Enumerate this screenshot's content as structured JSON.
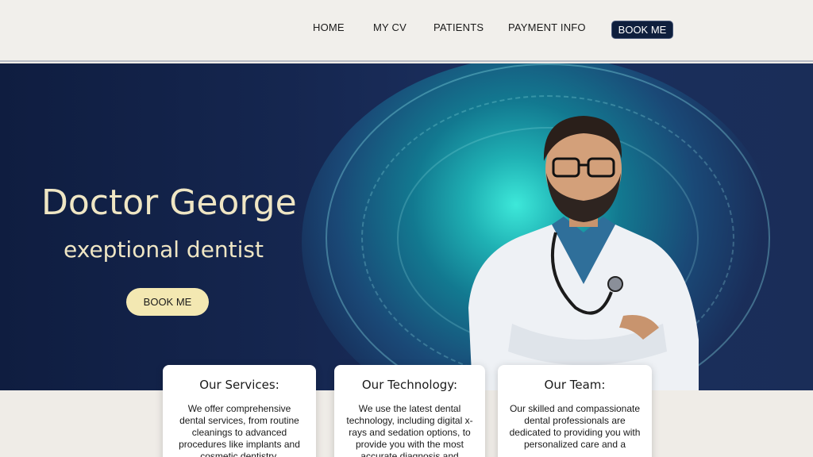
{
  "nav": {
    "home": "HOME",
    "cv": "MY CV",
    "patients": "PATIENTS",
    "payment": "PAYMENT INFO",
    "book": "BOOK ME"
  },
  "hero": {
    "title": "Doctor George",
    "subtitle": "exeptional dentist",
    "book": "BOOK ME"
  },
  "cards": [
    {
      "title": "Our Services:",
      "text": "We offer comprehensive dental services, from routine cleanings to advanced procedures like implants and cosmetic dentistry."
    },
    {
      "title": "Our Technology:",
      "text": "We use the latest dental technology, including digital x-rays and sedation options, to provide you with the most accurate diagnosis and"
    },
    {
      "title": "Our Team:",
      "text": "Our skilled and compassionate dental professionals are dedicated to providing you with personalized care and a"
    }
  ],
  "colors": {
    "nav_button": "#0f1f3d",
    "hero_bg": "#15264f",
    "hero_text": "#efe6c4",
    "hero_button": "#f3e8b2",
    "halo": "#3ff2e0"
  }
}
